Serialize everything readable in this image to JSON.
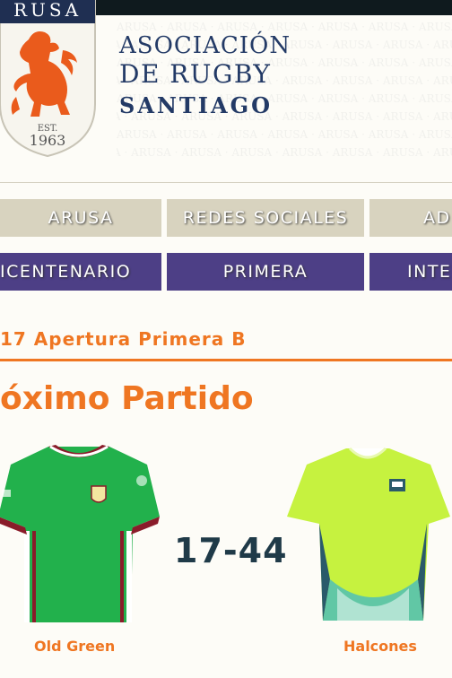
{
  "header": {
    "logo": {
      "arc_text": "RUSA",
      "est_label": "EST.",
      "est_year": "1963"
    },
    "org_name": {
      "line1": "ASOCIACIÓN",
      "line2": "DE RUGBY",
      "line3": "SANTIAGO"
    },
    "watermark_text": "ARUSA · ARUSA · ARUSA · ARUSA · ARUSA · ARUSA · ARUSA · ARUSA · ARUSA"
  },
  "nav": {
    "row1": [
      {
        "label": "ARUSA"
      },
      {
        "label": "REDES SOCIALES"
      },
      {
        "label": "AD"
      }
    ],
    "row2": [
      {
        "label": "ICENTENARIO"
      },
      {
        "label": "PRIMERA"
      },
      {
        "label": "INTE"
      }
    ]
  },
  "match": {
    "season_title": "17 Apertura Primera B",
    "section_title": "óximo Partido",
    "home_team": "Old Green",
    "away_team": "Halcones",
    "score": "17-44"
  },
  "colors": {
    "accent": "#ef7622",
    "brand_navy": "#233a66",
    "nav_beige": "#d8d3bf",
    "nav_purple": "#4d3f86",
    "home_jersey": "#22b14c",
    "away_jersey": "#c6f23f"
  }
}
